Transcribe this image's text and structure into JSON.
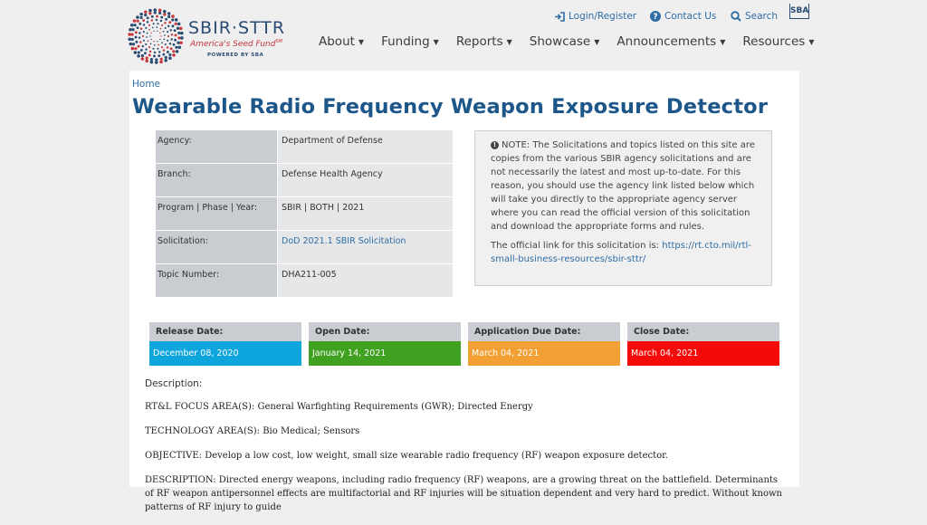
{
  "header": {
    "logo": {
      "title": "SBIR·STTR",
      "tagline": "America's Seed Fund",
      "trademark": "SM",
      "powered": "POWERED BY SBA"
    },
    "util_links": [
      {
        "label": "Login/Register",
        "icon": "login-icon"
      },
      {
        "label": "Contact Us",
        "icon": "question-circle-icon"
      },
      {
        "label": "Search",
        "icon": "search-icon"
      }
    ],
    "sba_badge": "SBA",
    "nav": [
      {
        "label": "About"
      },
      {
        "label": "Funding"
      },
      {
        "label": "Reports"
      },
      {
        "label": "Showcase"
      },
      {
        "label": "Announcements"
      },
      {
        "label": "Resources"
      }
    ]
  },
  "breadcrumb": "Home",
  "page_title": "Wearable Radio Frequency Weapon Exposure Detector",
  "info_table": [
    {
      "label": "Agency:",
      "value": "Department of Defense"
    },
    {
      "label": "Branch:",
      "value": "Defense Health Agency"
    },
    {
      "label": "Program | Phase | Year:",
      "value": "SBIR | BOTH | 2021"
    },
    {
      "label": "Solicitation:",
      "value": "DoD 2021.1 SBIR Solicitation"
    },
    {
      "label": "Topic Number:",
      "value": "DHA211-005"
    }
  ],
  "note": {
    "text": "NOTE: The Solicitations and topics listed on this site are copies from the various SBIR agency solicitations and are not necessarily the latest and most up-to-date. For this reason, you should use the agency link listed below which will take you directly to the appropriate agency server where you can read the official version of this solicitation and download the appropriate forms and rules.",
    "link_prefix": "The official link for this solicitation is: ",
    "link": "https://rt.cto.mil/rtl-small-business-resources/sbir-sttr/"
  },
  "dates": [
    {
      "label": "Release Date:",
      "value": "December 08, 2020",
      "color": "#0ea5dd"
    },
    {
      "label": "Open Date:",
      "value": "January 14, 2021",
      "color": "#40a020"
    },
    {
      "label": "Application Due Date:",
      "value": "March 04, 2021",
      "color": "#f2a033"
    },
    {
      "label": "Close Date:",
      "value": "March 04, 2021",
      "color": "#f50a0a"
    }
  ],
  "description": {
    "heading": "Description:",
    "paragraphs": [
      "RT&L FOCUS AREA(S): General Warfighting Requirements (GWR); Directed Energy",
      "TECHNOLOGY AREA(S): Bio Medical; Sensors",
      "OBJECTIVE: Develop a low cost, low weight, small size wearable radio frequency (RF) weapon exposure detector.",
      "DESCRIPTION: Directed energy weapons, including radio frequency (RF) weapons, are a growing threat on the battlefield. Determinants of RF weapon antipersonnel effects are multifactorial and RF injuries will be situation dependent and very hard to predict.  Without known patterns of RF injury to guide"
    ]
  },
  "colors": {
    "brand_blue": "#1d578a",
    "link_blue": "#2f6da5",
    "logo_red": "#c6363c"
  }
}
